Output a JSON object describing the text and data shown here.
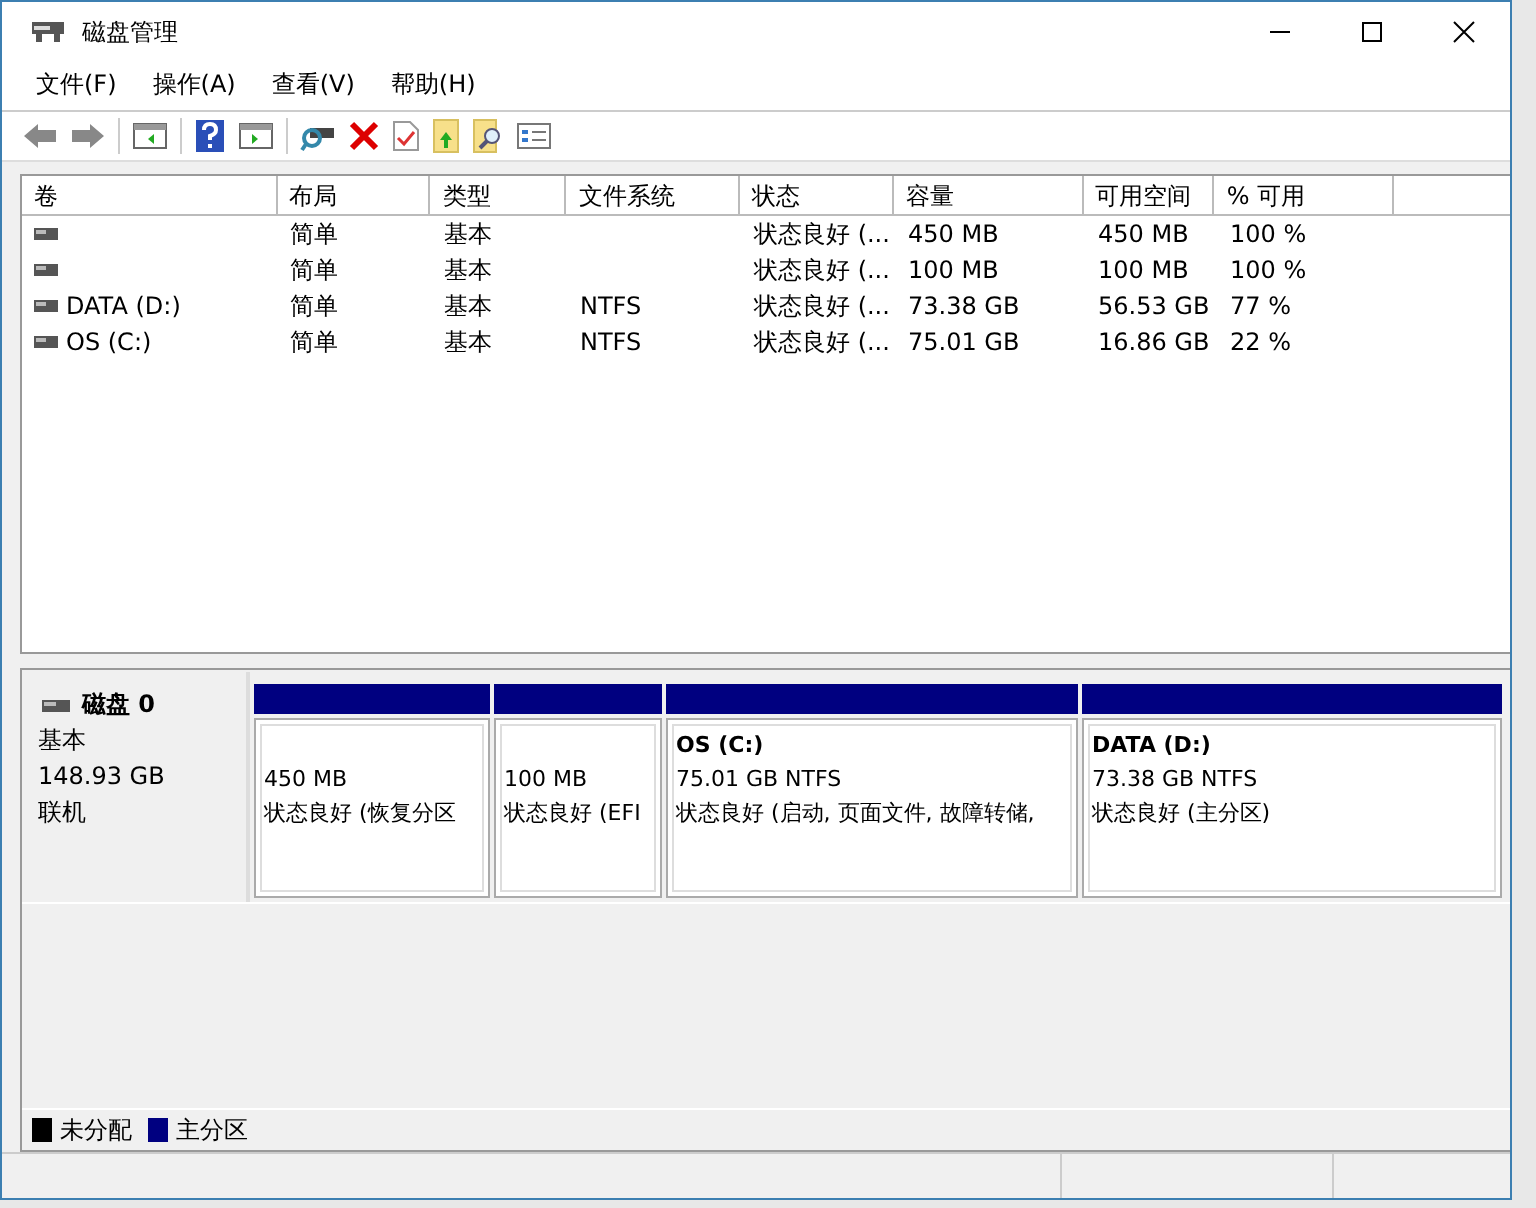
{
  "window": {
    "title": "磁盘管理"
  },
  "menu": [
    "文件(F)",
    "操作(A)",
    "查看(V)",
    "帮助(H)"
  ],
  "table": {
    "columns": [
      "卷",
      "布局",
      "类型",
      "文件系统",
      "状态",
      "容量",
      "可用空间",
      "% 可用"
    ],
    "rows": [
      [
        "",
        "简单",
        "基本",
        "",
        "状态良好 (...",
        "450 MB",
        "450 MB",
        "100 %"
      ],
      [
        "",
        "简单",
        "基本",
        "",
        "状态良好 (...",
        "100 MB",
        "100 MB",
        "100 %"
      ],
      [
        "DATA (D:)",
        "简单",
        "基本",
        "NTFS",
        "状态良好 (...",
        "73.38 GB",
        "56.53 GB",
        "77 %"
      ],
      [
        "OS (C:)",
        "简单",
        "基本",
        "NTFS",
        "状态良好 (...",
        "75.01 GB",
        "16.86 GB",
        "22 %"
      ]
    ]
  },
  "disk": {
    "name": "磁盘 0",
    "type": "基本",
    "size": "148.93 GB",
    "status": "联机",
    "partitions": [
      {
        "size": "450 MB",
        "status": "状态良好 (恢复分区"
      },
      {
        "size": "100 MB",
        "status": "状态良好 (EFI"
      },
      {
        "title": "OS  (C:)",
        "size": "75.01 GB NTFS",
        "status": "状态良好 (启动, 页面文件, 故障转储,"
      },
      {
        "title": "DATA  (D:)",
        "size": "73.38 GB NTFS",
        "status": "状态良好 (主分区)"
      }
    ]
  },
  "legend": [
    {
      "label": "未分配",
      "color": "#000000"
    },
    {
      "label": "主分区",
      "color": "#000080"
    }
  ]
}
